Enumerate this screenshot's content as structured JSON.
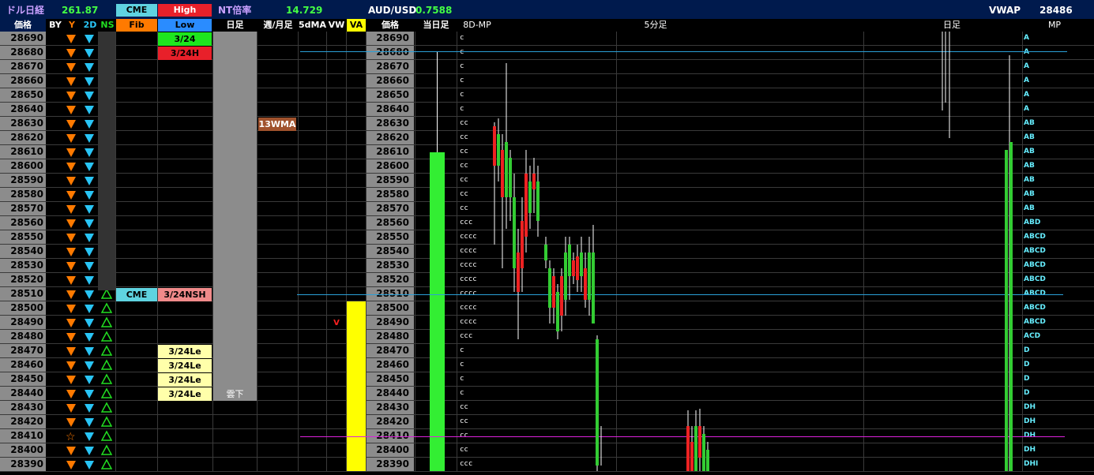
{
  "top": {
    "nikkei_label": "ドル日経",
    "nikkei_value": "261.87",
    "cme_label": "CME",
    "high_label": "High",
    "nt_label": "NT倍率",
    "nt_value": "14.729",
    "aud_label": "AUD/USD",
    "aud_value": "0.7588",
    "vwap_label": "VWAP",
    "vwap_value": "28486"
  },
  "header": {
    "price_left": "価格",
    "by": "BY",
    "y": "Y",
    "two_d": "2D",
    "ns": "NS",
    "fib": "Fib",
    "low": "Low",
    "daily": "日足",
    "week_month": "週/月足",
    "five_dma": "5dMA",
    "vw": "VW",
    "va": "VA",
    "price_right": "価格",
    "today": "当日足",
    "eight_d_mp": "8D-MP",
    "five_min": "5分足",
    "daily2": "日足",
    "mp": "MP"
  },
  "labels": {
    "d324": "3/24",
    "d324h": "3/24H",
    "wma13": "13WMA",
    "cme": "CME",
    "d324nsh": "3/24NSH",
    "d324le": "3/24Le",
    "kumo": "雲下",
    "v_mark": "V"
  },
  "rows": [
    {
      "price": "28690",
      "tpo": "c",
      "mp": "A"
    },
    {
      "price": "28680",
      "tpo": "c",
      "mp": "A"
    },
    {
      "price": "28670",
      "tpo": "c",
      "mp": "A"
    },
    {
      "price": "28660",
      "tpo": "c",
      "mp": "A"
    },
    {
      "price": "28650",
      "tpo": "c",
      "mp": "A"
    },
    {
      "price": "28640",
      "tpo": "c",
      "mp": "A"
    },
    {
      "price": "28630",
      "tpo": "cc",
      "mp": "AB"
    },
    {
      "price": "28620",
      "tpo": "cc",
      "mp": "AB"
    },
    {
      "price": "28610",
      "tpo": "cc",
      "mp": "AB"
    },
    {
      "price": "28600",
      "tpo": "cc",
      "mp": "AB"
    },
    {
      "price": "28590",
      "tpo": "cc",
      "mp": "AB"
    },
    {
      "price": "28580",
      "tpo": "cc",
      "mp": "AB"
    },
    {
      "price": "28570",
      "tpo": "cc",
      "mp": "AB"
    },
    {
      "price": "28560",
      "tpo": "ccc",
      "mp": "ABD"
    },
    {
      "price": "28550",
      "tpo": "cccc",
      "mp": "ABCD"
    },
    {
      "price": "28540",
      "tpo": "cccc",
      "mp": "ABCD"
    },
    {
      "price": "28530",
      "tpo": "cccc",
      "mp": "ABCD"
    },
    {
      "price": "28520",
      "tpo": "cccc",
      "mp": "ABCD"
    },
    {
      "price": "28510",
      "tpo": "cccc",
      "mp": "ABCD"
    },
    {
      "price": "28500",
      "tpo": "cccc",
      "mp": "ABCD"
    },
    {
      "price": "28490",
      "tpo": "cccc",
      "mp": "ABCD"
    },
    {
      "price": "28480",
      "tpo": "ccc",
      "mp": "ACD"
    },
    {
      "price": "28470",
      "tpo": "c",
      "mp": "D"
    },
    {
      "price": "28460",
      "tpo": "c",
      "mp": "D"
    },
    {
      "price": "28450",
      "tpo": "c",
      "mp": "D"
    },
    {
      "price": "28440",
      "tpo": "c",
      "mp": "D"
    },
    {
      "price": "28430",
      "tpo": "cc",
      "mp": "DH"
    },
    {
      "price": "28420",
      "tpo": "cc",
      "mp": "DH"
    },
    {
      "price": "28410",
      "tpo": "cc",
      "mp": "DH"
    },
    {
      "price": "28400",
      "tpo": "cc",
      "mp": "DH"
    },
    {
      "price": "28390",
      "tpo": "ccc",
      "mp": "DHI"
    }
  ],
  "colors": {
    "orange": "#ff7a00",
    "cyan": "#29c5f6",
    "green_tri": "#22dd22",
    "yellow": "#ffff00",
    "today_bar": "#33ee33",
    "blue_line": "#2aa0d8",
    "magenta_line": "#dd22dd"
  }
}
